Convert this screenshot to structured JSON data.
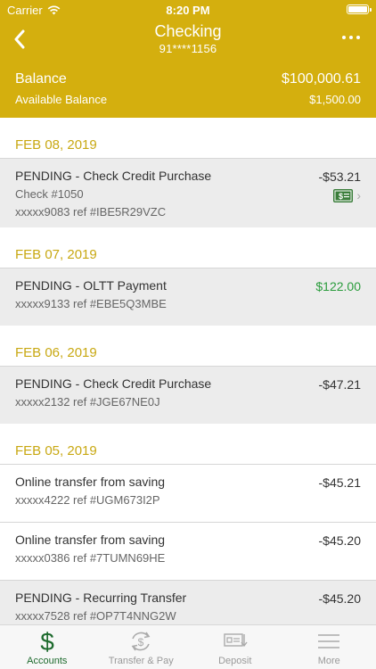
{
  "status_bar": {
    "carrier": "Carrier",
    "time": "8:20 PM"
  },
  "header": {
    "title": "Checking",
    "account_masked": "91****1156",
    "balance_label": "Balance",
    "balance_value": "$100,000.61",
    "available_label": "Available Balance",
    "available_value": "$1,500.00",
    "accent_color": "#d4af0e"
  },
  "transactions": [
    {
      "date": "FEB 08, 2019",
      "items": [
        {
          "description": "PENDING - Check Credit Purchase",
          "detail": "Check #1050",
          "reference": "xxxxx9083 ref #IBE5R29VZC",
          "amount": "-$53.21",
          "has_check_image": true
        }
      ]
    },
    {
      "date": "FEB 07, 2019",
      "items": [
        {
          "description": "PENDING - OLTT Payment",
          "reference": "xxxxx9133 ref #EBE5Q3MBE",
          "amount": "$122.00"
        }
      ]
    },
    {
      "date": "FEB 06, 2019",
      "items": [
        {
          "description": "PENDING - Check Credit Purchase",
          "reference": "xxxxx2132 ref #JGE67NE0J",
          "amount": "-$47.21"
        }
      ]
    },
    {
      "date": "FEB 05, 2019",
      "items": [
        {
          "description": "Online transfer from saving",
          "reference": "xxxxx4222 ref #UGM673I2P",
          "amount": "-$45.21"
        },
        {
          "description": "Online transfer from saving",
          "reference": "xxxxx0386 ref #7TUMN69HE",
          "amount": "-$45.20"
        },
        {
          "description": "PENDING - Recurring Transfer",
          "reference": "xxxxx7528 ref #OP7T4NNG2W",
          "amount": "-$45.20"
        }
      ]
    }
  ],
  "tabs": [
    {
      "label": "Accounts",
      "icon": "dollar-icon",
      "active": true
    },
    {
      "label": "Transfer & Pay",
      "icon": "transfer-pay-icon",
      "active": false
    },
    {
      "label": "Deposit",
      "icon": "deposit-check-icon",
      "active": false
    },
    {
      "label": "More",
      "icon": "hamburger-menu-icon",
      "active": false
    }
  ],
  "colors": {
    "credit": "#2a9c3c",
    "active_tab": "#1e6b2e",
    "date_header": "#c8a812"
  }
}
